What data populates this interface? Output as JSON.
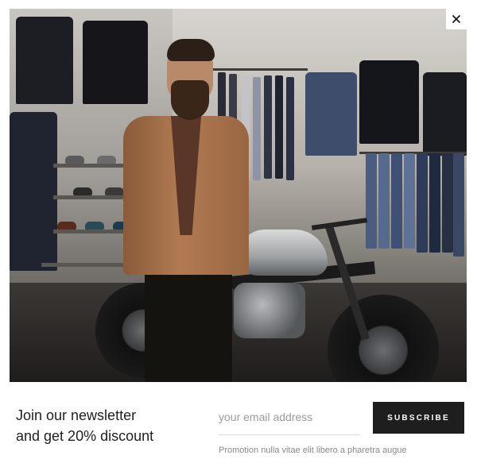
{
  "hero": {
    "scene": "bearded-man-in-tan-blazer-with-motorcycle-in-menswear-store"
  },
  "close": {
    "icon": "close-icon",
    "glyph": "×"
  },
  "newsletter": {
    "headline_line1": "Join our newsletter",
    "headline_line2": "and get 20% discount",
    "email_placeholder": "your email address",
    "subscribe_label": "SUBSCRIBE",
    "promo_text": "Promotion nulla vitae elit libero a pharetra augue"
  },
  "colors": {
    "button_bg": "#1e1e1e",
    "button_text": "#ffffff",
    "headline": "#1f1f1f",
    "muted": "#8a8a8a"
  }
}
